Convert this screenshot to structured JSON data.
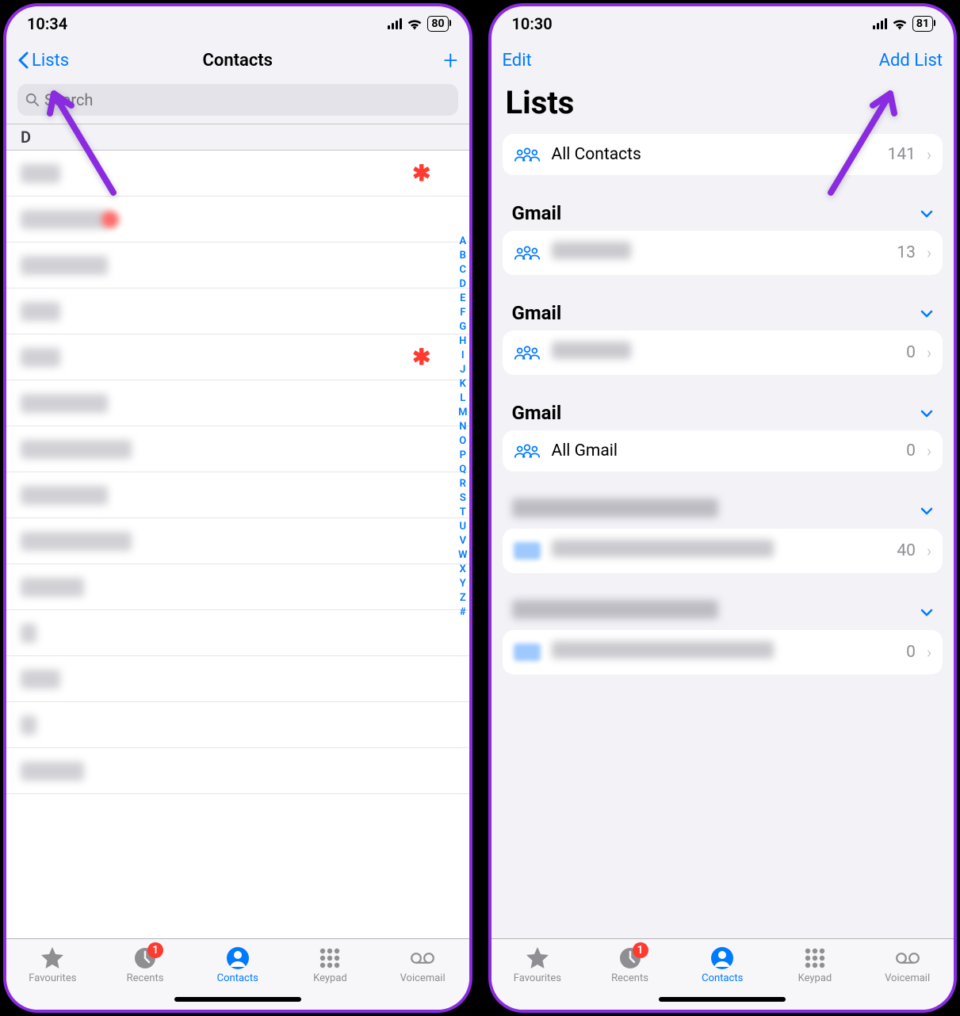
{
  "left": {
    "status": {
      "time": "10:34",
      "battery": "80"
    },
    "nav": {
      "back": "Lists",
      "title": "Contacts"
    },
    "search": {
      "placeholder": "Search"
    },
    "section": "D",
    "alpha": [
      "A",
      "B",
      "C",
      "D",
      "E",
      "F",
      "G",
      "H",
      "I",
      "J",
      "K",
      "L",
      "M",
      "N",
      "O",
      "P",
      "Q",
      "R",
      "S",
      "T",
      "U",
      "V",
      "W",
      "X",
      "Y",
      "Z",
      "#"
    ]
  },
  "right": {
    "status": {
      "time": "10:30",
      "battery": "81"
    },
    "nav": {
      "edit": "Edit",
      "add": "Add List"
    },
    "title": "Lists",
    "all": {
      "label": "All Contacts",
      "count": "141"
    },
    "accounts": [
      {
        "name": "Gmail",
        "rows": [
          {
            "label": "",
            "count": "13"
          }
        ]
      },
      {
        "name": "Gmail",
        "rows": [
          {
            "label": "",
            "count": "0"
          }
        ]
      },
      {
        "name": "Gmail",
        "rows": [
          {
            "label": "All Gmail",
            "count": "0"
          }
        ]
      },
      {
        "name": "",
        "rows": [
          {
            "label": "",
            "count": "40"
          }
        ]
      },
      {
        "name": "",
        "rows": [
          {
            "label": "",
            "count": "0"
          }
        ]
      }
    ]
  },
  "tabs": {
    "items": [
      {
        "key": "favourites",
        "label": "Favourites"
      },
      {
        "key": "recents",
        "label": "Recents",
        "badge": "1"
      },
      {
        "key": "contacts",
        "label": "Contacts",
        "active": true
      },
      {
        "key": "keypad",
        "label": "Keypad"
      },
      {
        "key": "voicemail",
        "label": "Voicemail"
      }
    ]
  }
}
